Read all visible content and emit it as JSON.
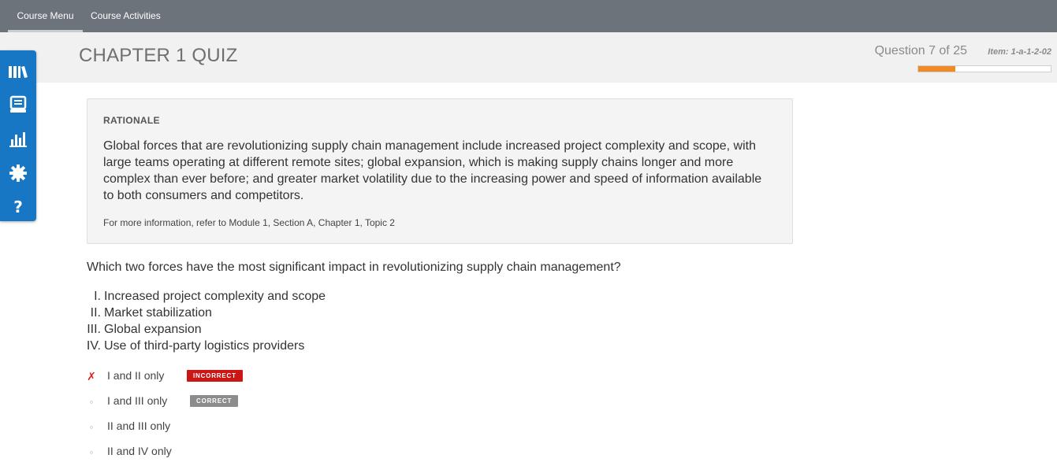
{
  "nav": {
    "tabs": [
      {
        "label": "Course Menu"
      },
      {
        "label": "Course Activities"
      }
    ]
  },
  "header": {
    "title": "CHAPTER 1 QUIZ",
    "question_count": "Question 7 of 25",
    "item_id": "Item: 1-a-1-2-02",
    "progress": 0.28
  },
  "sidebar": {
    "icons": [
      "library-icon",
      "notebook-icon",
      "chart-icon",
      "gear-icon",
      "help-icon"
    ]
  },
  "rationale": {
    "heading": "RATIONALE",
    "body": "Global forces that are revolutionizing supply chain management include increased project complexity and scope, with large teams operating at different remote sites; global expansion, which is making supply chains longer and more complex than ever before; and greater market volatility due to the increasing power and speed of information available to both consumers and competitors.",
    "reference": "For more information, refer to Module 1, Section A, Chapter 1, Topic 2"
  },
  "question": {
    "text": "Which two forces have the most significant impact in revolutionizing supply chain management?",
    "statements": [
      {
        "num": "I.",
        "text": "Increased project complexity and scope"
      },
      {
        "num": "II.",
        "text": "Market stabilization"
      },
      {
        "num": "III.",
        "text": "Global expansion"
      },
      {
        "num": "IV.",
        "text": "Use of third-party logistics providers"
      }
    ],
    "choices": [
      {
        "label": "I and II only",
        "mark": "✗",
        "badge": "INCORRECT"
      },
      {
        "label": "I and III only",
        "mark": "◦",
        "badge": "CORRECT"
      },
      {
        "label": "II and III only",
        "mark": "◦"
      },
      {
        "label": "II and IV only",
        "mark": "◦"
      }
    ]
  },
  "colors": {
    "topbar": "#6c737b",
    "sidebar": "#1877c4",
    "progress": "#ef8a24",
    "incorrect": "#cc1616",
    "correct": "#8c8c8c"
  }
}
